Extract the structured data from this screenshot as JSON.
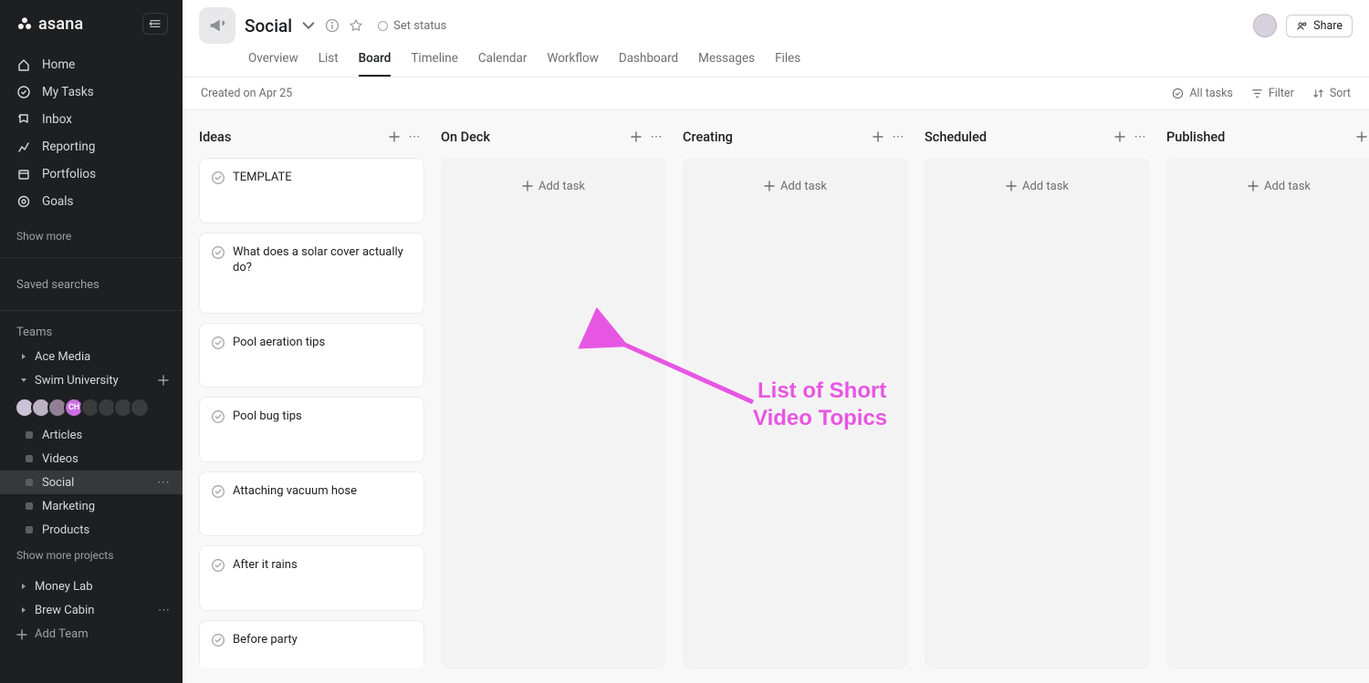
{
  "brand": "asana",
  "sidebar": {
    "nav": [
      {
        "label": "Home"
      },
      {
        "label": "My Tasks"
      },
      {
        "label": "Inbox"
      },
      {
        "label": "Reporting"
      },
      {
        "label": "Portfolios"
      },
      {
        "label": "Goals"
      }
    ],
    "show_more": "Show more",
    "saved_searches": "Saved searches",
    "teams_heading": "Teams",
    "teams": [
      {
        "label": "Ace Media",
        "expanded": false
      },
      {
        "label": "Swim University",
        "expanded": true
      }
    ],
    "avatar_badge": "CH",
    "projects": [
      {
        "label": "Articles"
      },
      {
        "label": "Videos"
      },
      {
        "label": "Social",
        "active": true
      },
      {
        "label": "Marketing"
      },
      {
        "label": "Products"
      }
    ],
    "show_more_projects": "Show more projects",
    "other_teams": [
      {
        "label": "Money Lab"
      },
      {
        "label": "Brew Cabin",
        "has_more": true
      }
    ],
    "add_team": "Add Team"
  },
  "header": {
    "title": "Social",
    "set_status": "Set status",
    "share": "Share",
    "tabs": [
      "Overview",
      "List",
      "Board",
      "Timeline",
      "Calendar",
      "Workflow",
      "Dashboard",
      "Messages",
      "Files"
    ],
    "active_tab": "Board"
  },
  "subbar": {
    "created": "Created on Apr 25",
    "all_tasks": "All tasks",
    "filter": "Filter",
    "sort": "Sort"
  },
  "board": {
    "add_task": "Add task",
    "columns": [
      {
        "title": "Ideas",
        "cards": [
          "TEMPLATE",
          "What does a solar cover actually do?",
          "Pool aeration tips",
          "Pool bug tips",
          "Attaching vacuum hose",
          "After it rains",
          "Before party"
        ]
      },
      {
        "title": "On Deck",
        "cards": []
      },
      {
        "title": "Creating",
        "cards": []
      },
      {
        "title": "Scheduled",
        "cards": []
      },
      {
        "title": "Published",
        "cards": []
      }
    ]
  },
  "annotation": {
    "line1": "List of Short",
    "line2": "Video Topics"
  }
}
